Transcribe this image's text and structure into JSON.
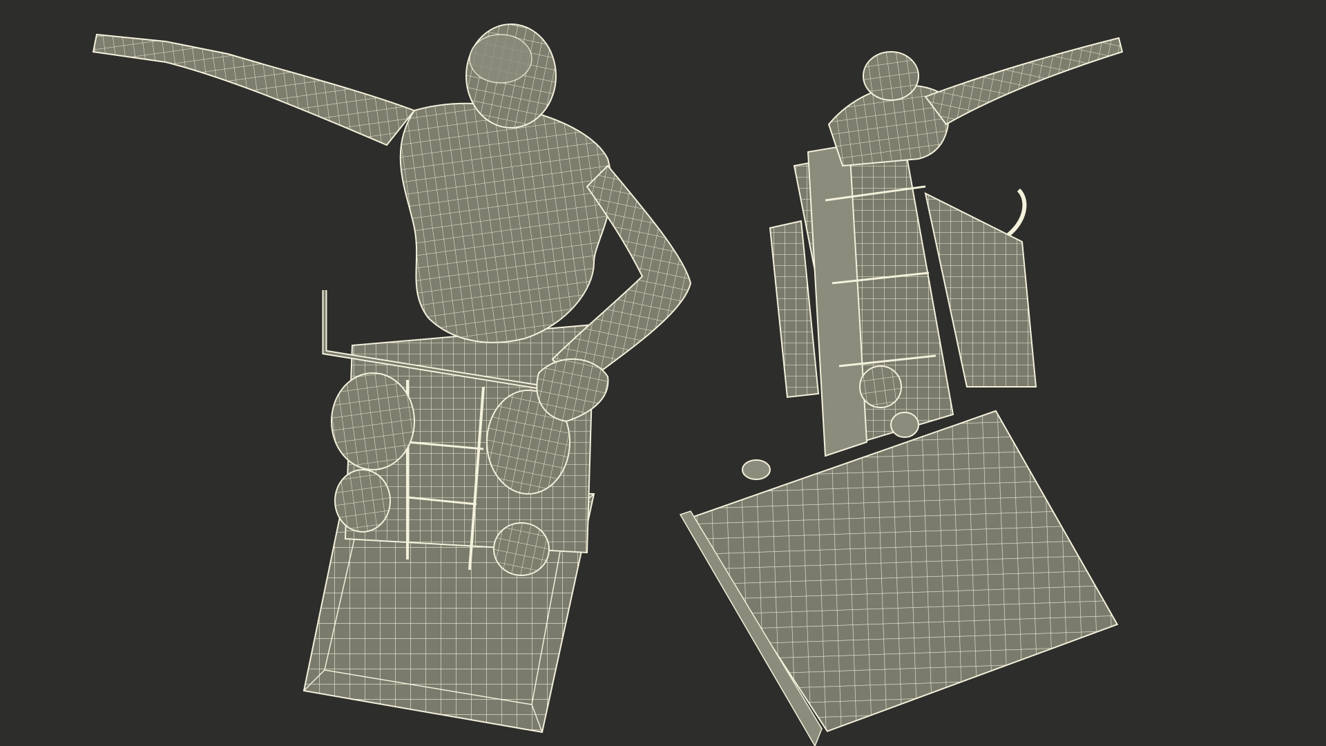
{
  "scene": {
    "background_color": "#2d2d2b",
    "mesh_fill_color": "#7a7b6c",
    "mesh_shade_color": "#8b8c7c",
    "wire_color": "#f4f1dc",
    "views": [
      {
        "name": "top-view",
        "subject": "man-on-wheelchair-ramp"
      },
      {
        "name": "angled-view",
        "subject": "man-on-wheelchair-ramp"
      }
    ]
  }
}
